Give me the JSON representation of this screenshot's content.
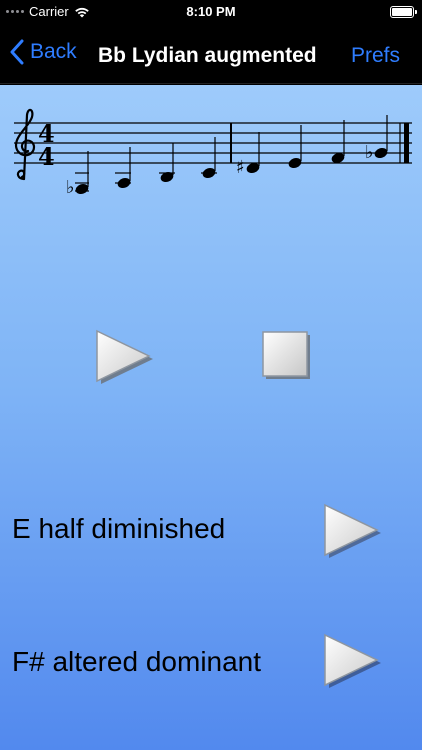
{
  "status_bar": {
    "carrier": "Carrier",
    "time": "8:10 PM"
  },
  "nav": {
    "back_label": "Back",
    "title": "Bb Lydian augmented",
    "prefs_label": "Prefs",
    "accent_color": "#2f7dff"
  },
  "score": {
    "time_signature_top": "4",
    "time_signature_bottom": "4"
  },
  "chords": [
    {
      "label": "E half diminished"
    },
    {
      "label": "F# altered dominant"
    }
  ],
  "colors": {
    "background_top": "#9ecbfb",
    "background_bottom": "#5289ee"
  }
}
